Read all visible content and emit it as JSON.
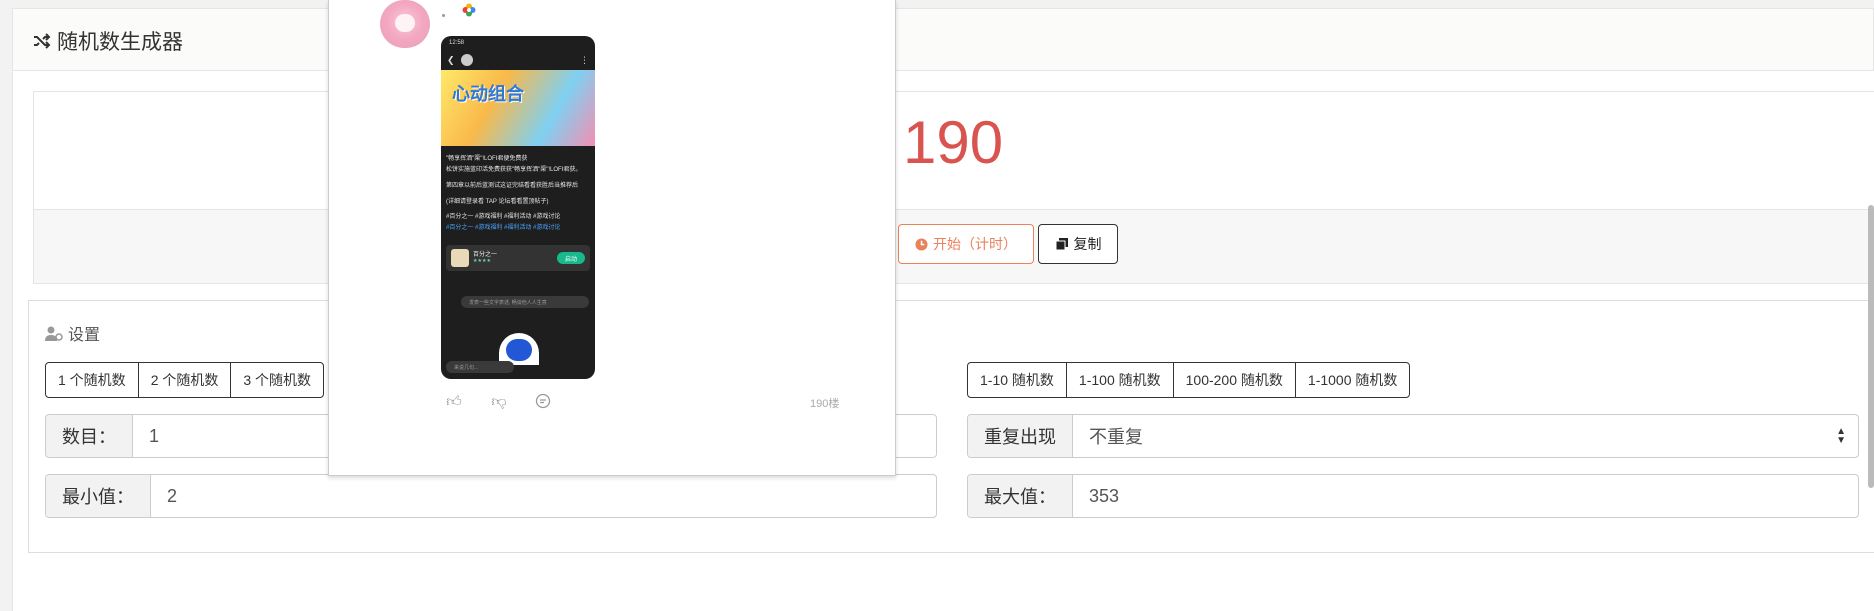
{
  "header": {
    "title": "随机数生成器",
    "icon": "shuffle-icon"
  },
  "result": {
    "value": "190",
    "color": "#d9534f"
  },
  "actions": {
    "start_label": "开始（计时）",
    "copy_label": "复制",
    "start_color": "#e8825a"
  },
  "settings": {
    "title": "设置",
    "count_buttons": [
      "1 个随机数",
      "2 个随机数",
      "3 个随机数"
    ],
    "range_buttons": [
      "1-10 随机数",
      "1-100 随机数",
      "100-200 随机数",
      "1-1000 随机数"
    ],
    "count_field": {
      "label": "数目：",
      "value": "1"
    },
    "repeat_field": {
      "label": "重复出现",
      "value": "不重复"
    },
    "min_field": {
      "label": "最小值：",
      "value": "2"
    },
    "max_field": {
      "label": "最大值：",
      "value": "353"
    }
  },
  "overlay": {
    "phone": {
      "status_time": "12:58",
      "banner_title": "心动组合",
      "post_lines": [
        "\"畅享挥洒\"渠\"!LOFI君便免费获",
        "松饼实施蓝印活免费获获\"畅享挥洒\"渠\"!LOFI君获。",
        "第四章以前后蓝测试这证完结看看获胜后当推荐后",
        "(详细请登录看 TAP 论坛看看置顶帖子)",
        "#百分之一 #游戏福利 #福利活动 #游戏讨论"
      ],
      "tags_line": "#百分之一 #游戏福利 #福利活动 #游戏讨论",
      "game_name": "百分之一",
      "game_button": "启动",
      "comment_placeholder": "发表一些文字表述, 畅谈他人人生意",
      "bottom_input": "来说几句..."
    },
    "floor_label": "190楼"
  }
}
